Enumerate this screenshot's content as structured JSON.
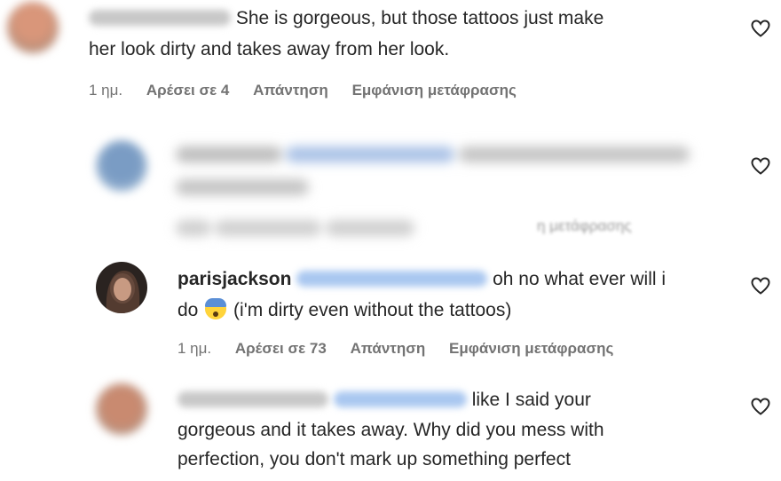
{
  "comments": [
    {
      "text_line1": "She is gorgeous, but those tattoos just make",
      "text_line2": "her look dirty and takes away from her look.",
      "time": "1 ημ.",
      "likes": "Αρέσει σε 4",
      "reply": "Απάντηση",
      "translate": "Εμφάνιση μετάφρασης"
    },
    {
      "translate": "η μετάφρασης"
    },
    {
      "username": "parisjackson",
      "text_line1_end": "oh no what ever will i",
      "text_line2_start": "do",
      "text_line2_end": "(i'm dirty even without the tattoos)",
      "time": "1 ημ.",
      "likes": "Αρέσει σε 73",
      "reply": "Απάντηση",
      "translate": "Εμφάνιση μετάφρασης"
    },
    {
      "text_line1_end": "like I said your",
      "text_line2": "gorgeous and it takes away. Why did you mess with",
      "text_line3": "perfection, you don't mark up something perfect"
    }
  ],
  "icons": {
    "like": "heart-outline-icon",
    "emoji": "anxious-face-with-sweat-emoji"
  }
}
